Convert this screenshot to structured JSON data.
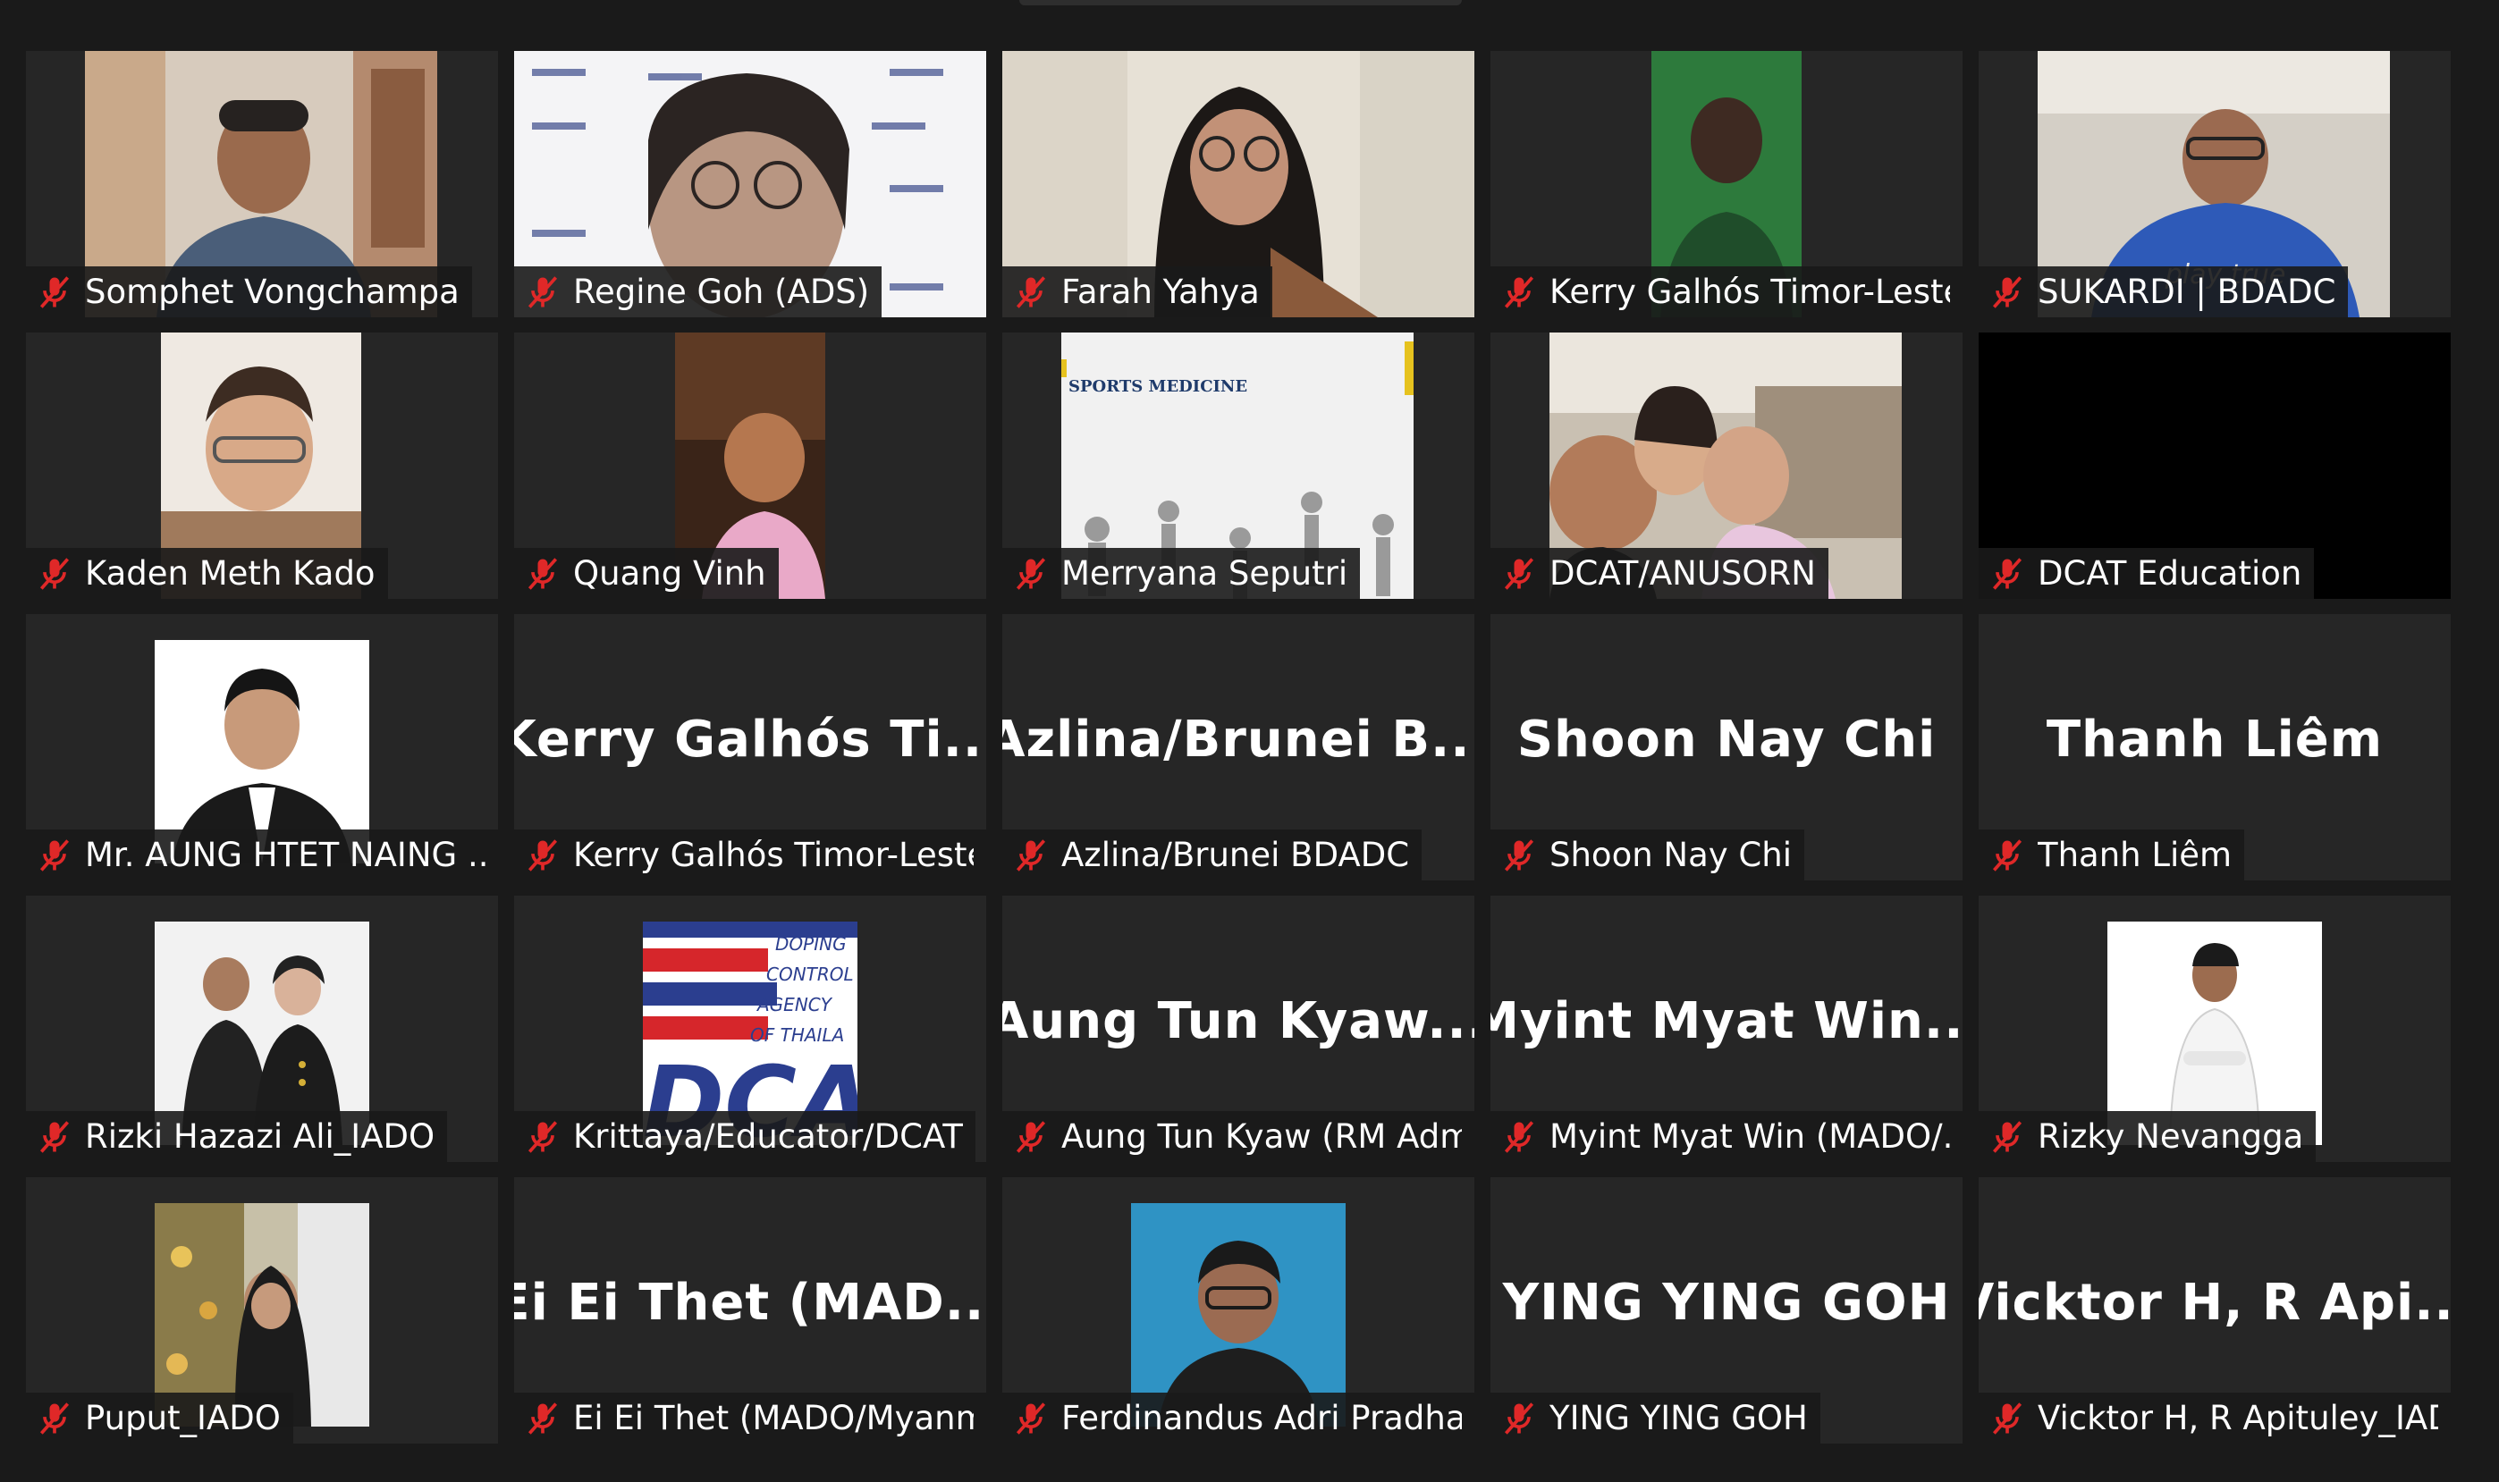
{
  "participants": [
    {
      "name": "Somphet Vongchampa",
      "video": "person"
    },
    {
      "name": "Regine Goh (ADS)",
      "video": "person"
    },
    {
      "name": "Farah Yahya",
      "video": "person"
    },
    {
      "name": "Kerry Galhós Timor-Leste",
      "video": "person"
    },
    {
      "name": "SUKARDI | BDADC",
      "video": "person"
    },
    {
      "name": "Kaden Meth Kado",
      "video": "person"
    },
    {
      "name": "Quang Vinh",
      "video": "person"
    },
    {
      "name": "Merryana Seputri",
      "video": "slide"
    },
    {
      "name": "DCAT/ANUSORN",
      "video": "group"
    },
    {
      "name": "DCAT Education",
      "video": "black"
    },
    {
      "name": "Mr. AUNG HTET NAING ...",
      "video": "photo"
    },
    {
      "name": "Kerry Galhós Timor-Leste ...",
      "display_name": "Kerry Galhós Ti...",
      "video": "none"
    },
    {
      "name": "Azlina/Brunei BDADC",
      "display_name": "Azlina/Brunei B...",
      "video": "none"
    },
    {
      "name": "Shoon Nay Chi",
      "display_name": "Shoon Nay Chi",
      "video": "none"
    },
    {
      "name": "Thanh Liêm",
      "display_name": "Thanh Liêm",
      "video": "none"
    },
    {
      "name": "Rizki Hazazi Ali_IADO",
      "video": "photo"
    },
    {
      "name": "Krittaya/Educator/DCAT",
      "video": "logo",
      "logo_text": [
        "DOPING",
        "CONTROL",
        "AGENCY",
        "OF THAILA",
        "DCAT"
      ]
    },
    {
      "name": "Aung Tun Kyaw (RM Adm...",
      "display_name": "Aung Tun Kyaw...",
      "video": "none"
    },
    {
      "name": "Myint Myat Win (MADO/...",
      "display_name": "Myint Myat Win...",
      "video": "none"
    },
    {
      "name": "Rizky Nevangga",
      "video": "photo"
    },
    {
      "name": "Puput_IADO",
      "video": "photo"
    },
    {
      "name": "Ei Ei Thet (MADO/Myanm...",
      "display_name": "Ei Ei Thet (MAD...",
      "video": "none"
    },
    {
      "name": "Ferdinandus Adri Pradha...",
      "video": "photo"
    },
    {
      "name": "YING YING GOH",
      "display_name": "YING YING GOH",
      "video": "none"
    },
    {
      "name": "Vicktor H, R Apituley_IADO",
      "display_name": "Vicktor H, R Api...",
      "video": "none"
    }
  ],
  "slide_text": "SPORTS MEDICINE",
  "colors": {
    "background": "#1a1a1a",
    "tile": "#262626",
    "mic_muted": "#e02828",
    "text": "#ffffff"
  }
}
